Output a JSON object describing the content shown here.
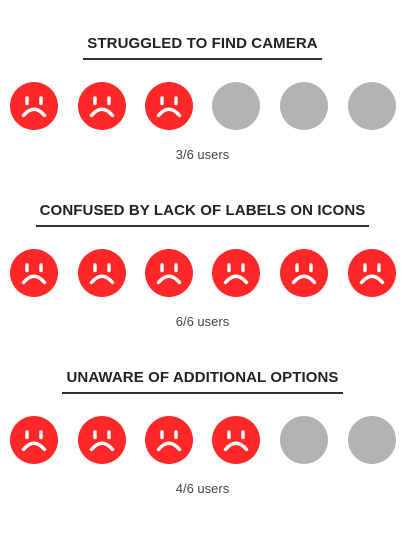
{
  "colors": {
    "frustrated": "#ff2828",
    "neutral": "#b3b3b3",
    "face_stroke": "#ffffff"
  },
  "findings": [
    {
      "title": "STRUGGLED TO FIND CAMERA",
      "affected": 3,
      "total": 6,
      "count_label": "3/6 users"
    },
    {
      "title": "CONFUSED BY LACK OF LABELS ON ICONS",
      "affected": 6,
      "total": 6,
      "count_label": "6/6 users"
    },
    {
      "title": "UNAWARE OF ADDITIONAL OPTIONS",
      "affected": 4,
      "total": 6,
      "count_label": "4/6 users"
    }
  ],
  "icons": {
    "affected": "sad-face-icon",
    "unaffected": "gray-circle-icon"
  }
}
